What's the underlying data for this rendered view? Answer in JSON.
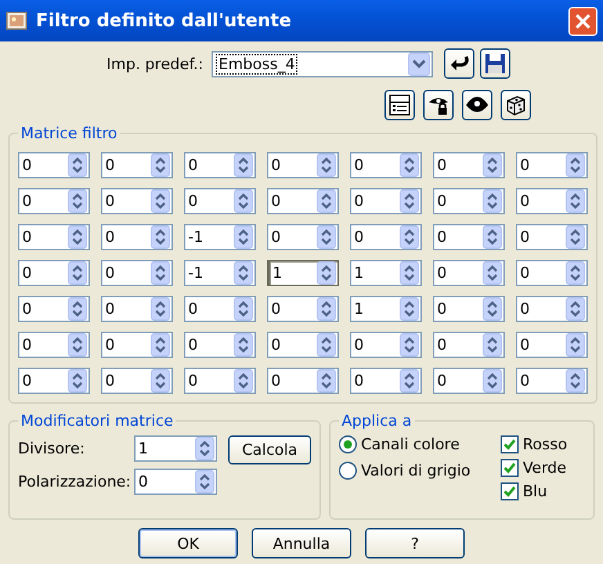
{
  "window": {
    "title": "Filtro definito dall'utente"
  },
  "preset": {
    "label": "Imp. predef.:",
    "value": "Emboss_4"
  },
  "matrix": {
    "title": "Matrice filtro",
    "rows": [
      [
        {
          "value": "0",
          "focused": false
        },
        {
          "value": "0",
          "focused": false
        },
        {
          "value": "0",
          "focused": false
        },
        {
          "value": "0",
          "focused": false
        },
        {
          "value": "0",
          "focused": false
        },
        {
          "value": "0",
          "focused": false
        },
        {
          "value": "0",
          "focused": false
        }
      ],
      [
        {
          "value": "0",
          "focused": false
        },
        {
          "value": "0",
          "focused": false
        },
        {
          "value": "0",
          "focused": false
        },
        {
          "value": "0",
          "focused": false
        },
        {
          "value": "0",
          "focused": false
        },
        {
          "value": "0",
          "focused": false
        },
        {
          "value": "0",
          "focused": false
        }
      ],
      [
        {
          "value": "0",
          "focused": false
        },
        {
          "value": "0",
          "focused": false
        },
        {
          "value": "-1",
          "focused": false
        },
        {
          "value": "0",
          "focused": false
        },
        {
          "value": "0",
          "focused": false
        },
        {
          "value": "0",
          "focused": false
        },
        {
          "value": "0",
          "focused": false
        }
      ],
      [
        {
          "value": "0",
          "focused": false
        },
        {
          "value": "0",
          "focused": false
        },
        {
          "value": "-1",
          "focused": false
        },
        {
          "value": "1",
          "focused": true
        },
        {
          "value": "1",
          "focused": false
        },
        {
          "value": "0",
          "focused": false
        },
        {
          "value": "0",
          "focused": false
        }
      ],
      [
        {
          "value": "0",
          "focused": false
        },
        {
          "value": "0",
          "focused": false
        },
        {
          "value": "0",
          "focused": false
        },
        {
          "value": "0",
          "focused": false
        },
        {
          "value": "1",
          "focused": false
        },
        {
          "value": "0",
          "focused": false
        },
        {
          "value": "0",
          "focused": false
        }
      ],
      [
        {
          "value": "0",
          "focused": false
        },
        {
          "value": "0",
          "focused": false
        },
        {
          "value": "0",
          "focused": false
        },
        {
          "value": "0",
          "focused": false
        },
        {
          "value": "0",
          "focused": false
        },
        {
          "value": "0",
          "focused": false
        },
        {
          "value": "0",
          "focused": false
        }
      ],
      [
        {
          "value": "0",
          "focused": false
        },
        {
          "value": "0",
          "focused": false
        },
        {
          "value": "0",
          "focused": false
        },
        {
          "value": "0",
          "focused": false
        },
        {
          "value": "0",
          "focused": false
        },
        {
          "value": "0",
          "focused": false
        },
        {
          "value": "0",
          "focused": false
        }
      ]
    ]
  },
  "modifiers": {
    "title": "Modificatori matrice",
    "fields": [
      {
        "label": "Divisore:",
        "value": "1"
      },
      {
        "label": "Polarizzazione:",
        "value": "0"
      }
    ],
    "button": "Calcola"
  },
  "apply": {
    "title": "Applica a",
    "radios": [
      {
        "label": "Canali colore",
        "selected": true
      },
      {
        "label": "Valori di grigio",
        "selected": false
      }
    ],
    "checks": [
      {
        "label": "Rosso",
        "checked": true
      },
      {
        "label": "Verde",
        "checked": true
      },
      {
        "label": "Blu",
        "checked": true
      }
    ]
  },
  "buttons": [
    "OK",
    "Annulla",
    "?"
  ]
}
